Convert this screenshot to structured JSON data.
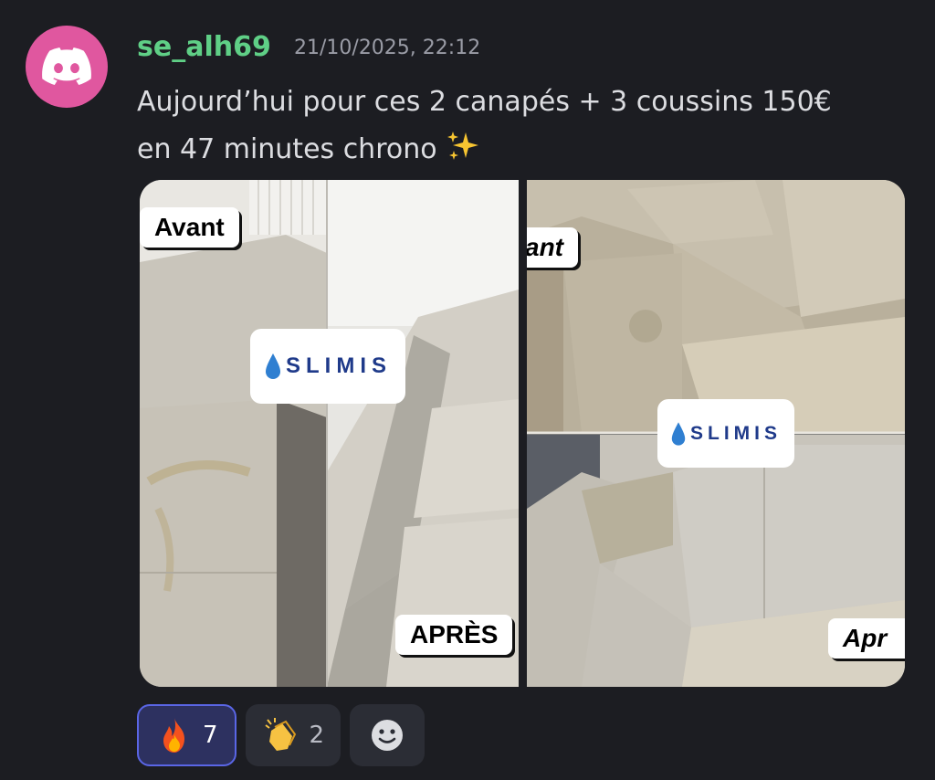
{
  "message": {
    "username": "se_alh69",
    "timestamp": "21/10/2025, 22:12",
    "text_line1": "Aujourd’hui pour ces 2 canapés + 3 coussins 150€",
    "text_line2": "en 47 minutes chrono",
    "sparkle_icon": "sparkles-emoji",
    "avatar_icon": "discord-logo-icon",
    "avatar_color": "#e0579f",
    "username_color": "#5fcf86"
  },
  "attachments": {
    "left": {
      "before_label": "Avant",
      "after_label": "APRÈS",
      "logo": "SLIMIS"
    },
    "right": {
      "before_label": "ant",
      "after_label": "Apr",
      "logo": "SLIMIS"
    }
  },
  "reactions": [
    {
      "emoji": "fire",
      "count": "7",
      "active": true
    },
    {
      "emoji": "clapping-hands",
      "count": "2",
      "active": false
    }
  ],
  "add_reaction_icon": "add-reaction-smiley-icon"
}
